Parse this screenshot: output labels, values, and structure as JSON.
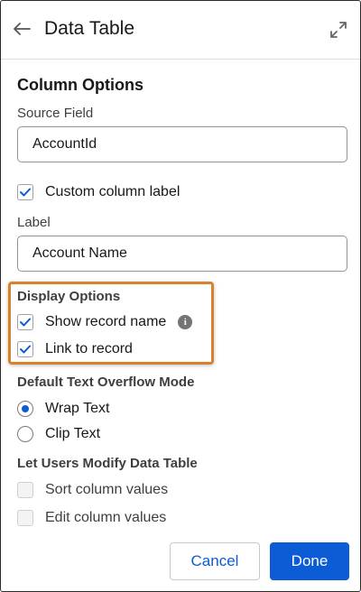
{
  "header": {
    "title": "Data Table",
    "back_icon": "arrow-left-icon",
    "expand_icon": "expand-icon"
  },
  "column_options": {
    "heading": "Column Options",
    "source_field": {
      "label": "Source Field",
      "value": "AccountId"
    },
    "custom_label_checkbox": {
      "label": "Custom column label",
      "checked": true
    },
    "label_field": {
      "label": "Label",
      "value": "Account Name"
    }
  },
  "display_options": {
    "heading": "Display Options",
    "show_record_name": {
      "label": "Show record name",
      "checked": true,
      "info_icon": "i"
    },
    "link_to_record": {
      "label": "Link to record",
      "checked": true
    }
  },
  "overflow_mode": {
    "heading": "Default Text Overflow Mode",
    "options": [
      {
        "label": "Wrap Text",
        "selected": true
      },
      {
        "label": "Clip Text",
        "selected": false
      }
    ]
  },
  "modify": {
    "heading": "Let Users Modify Data Table",
    "sort": {
      "label": "Sort column values",
      "checked": false,
      "disabled": true
    },
    "edit": {
      "label": "Edit column values",
      "checked": false,
      "disabled": true
    }
  },
  "footer": {
    "cancel_label": "Cancel",
    "done_label": "Done"
  },
  "colors": {
    "brand_blue": "#0b5cd5",
    "highlight_orange": "#d9822b"
  }
}
